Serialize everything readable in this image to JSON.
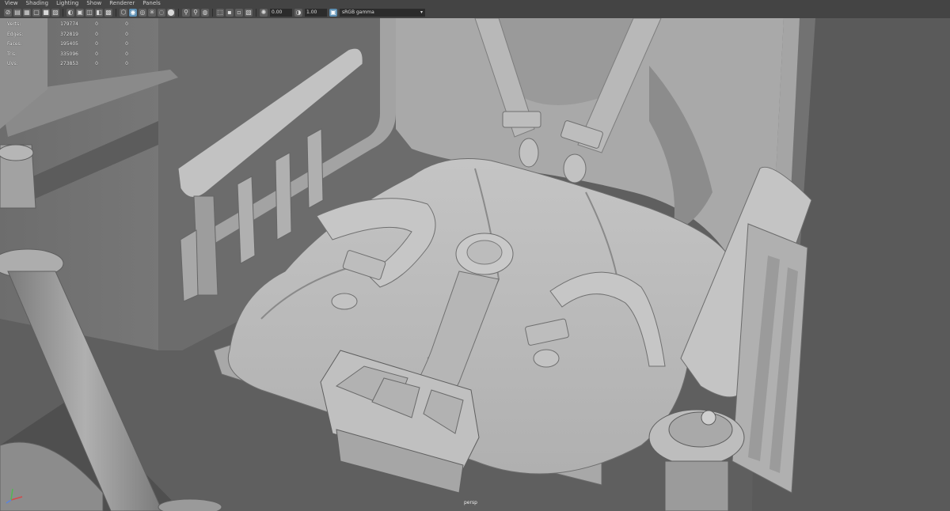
{
  "menu": [
    "View",
    "Shading",
    "Lighting",
    "Show",
    "Renderer",
    "Panels"
  ],
  "toolbar": {
    "icons": [
      "camera-icon",
      "bookmark-icon",
      "grid-icon",
      "wireframe-icon",
      "smooth-shade-icon",
      "textured-icon",
      "lighting-icon",
      "shadow-icon",
      "ao-icon",
      "motion-blur-icon",
      "aa-icon",
      "dof-icon",
      "isolate-icon",
      "xray-icon",
      "xray-joints-icon",
      "backface-icon",
      "resolution-gate-icon",
      "field-chart-icon",
      "safe-action-icon",
      "exposure-icon",
      "gamma-icon",
      "color-management-icon"
    ],
    "exposure_value": "0.00",
    "gamma_value": "1.00",
    "color_space": "sRGB gamma"
  },
  "hud": {
    "rows": [
      {
        "label": "Verts:",
        "value": "179774",
        "selected": "0",
        "components": "0"
      },
      {
        "label": "Edges:",
        "value": "372819",
        "selected": "0",
        "components": "0"
      },
      {
        "label": "Faces:",
        "value": "195405",
        "selected": "0",
        "components": "0"
      },
      {
        "label": "Tris:",
        "value": "335096",
        "selected": "0",
        "components": "0"
      },
      {
        "label": "UVs:",
        "value": "273853",
        "selected": "0",
        "components": "0"
      }
    ]
  },
  "viewport": {
    "camera": "persp"
  },
  "colors": {
    "ui_bg": "#444444",
    "viewport_bg": "#5a5a5a",
    "model_light": "#c9c9c9",
    "model_mid": "#a0a0a0",
    "model_dark": "#6e6e6e",
    "accent": "#5d8fb3"
  }
}
